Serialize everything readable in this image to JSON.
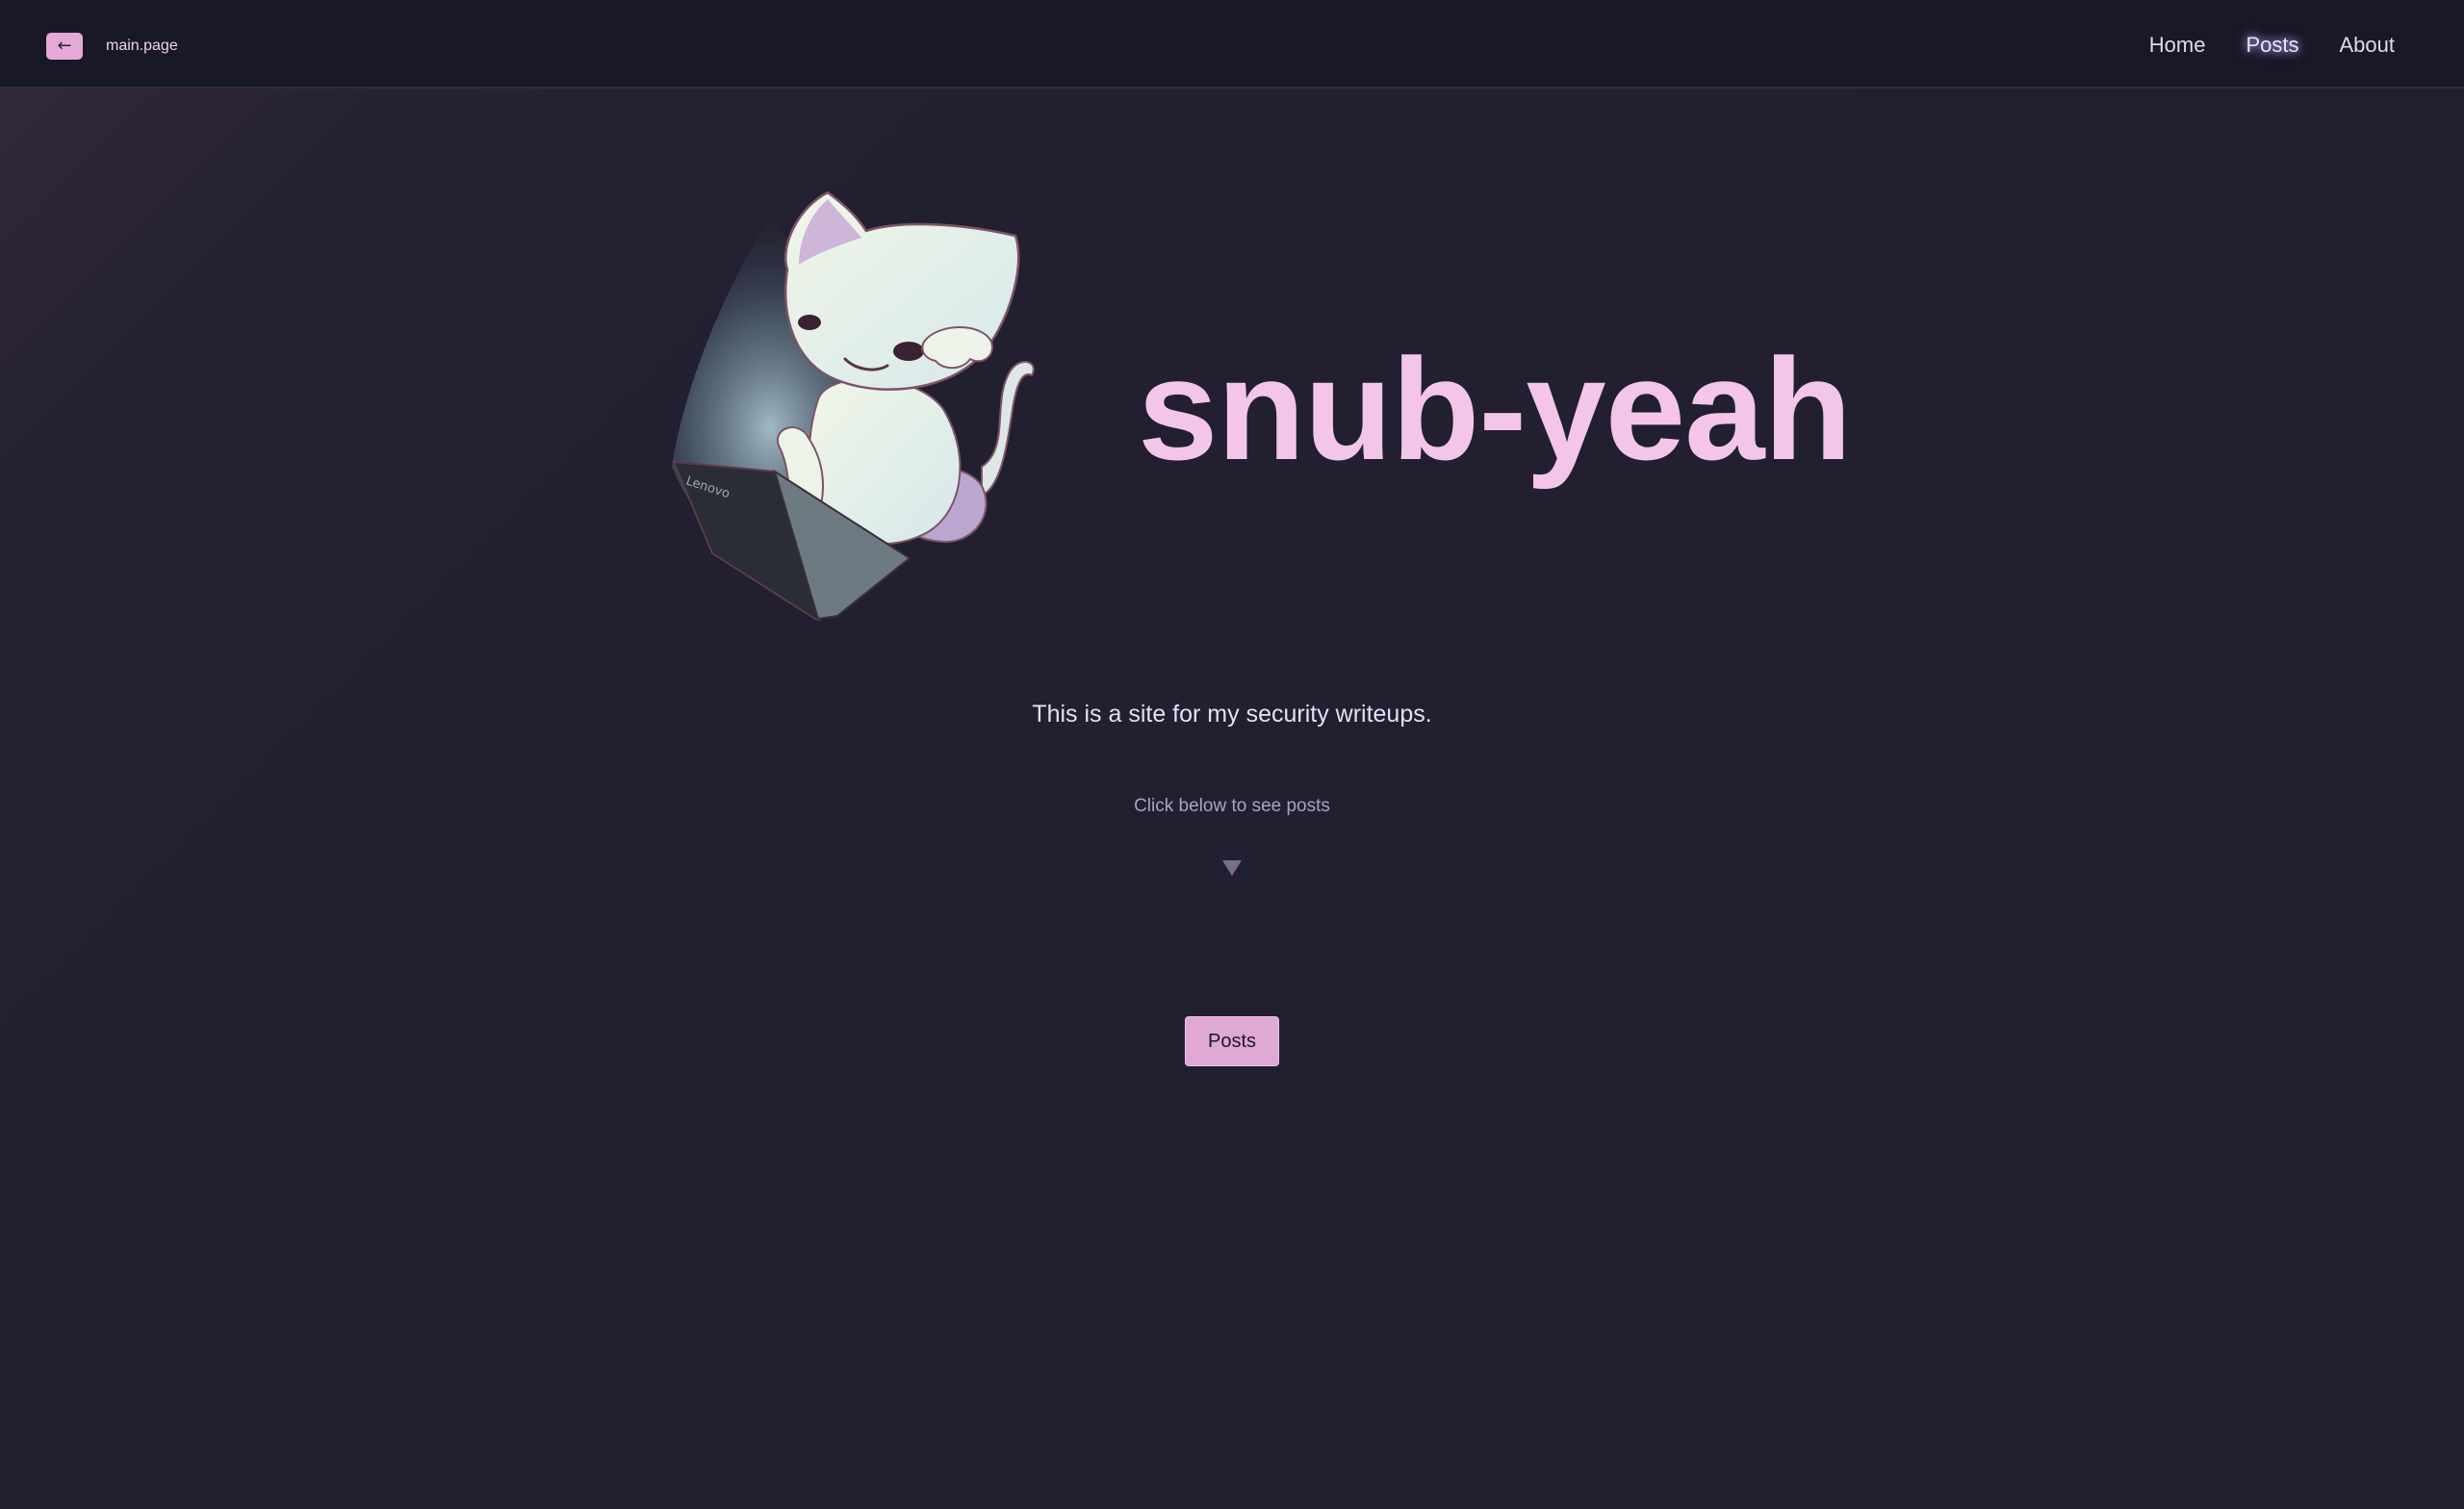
{
  "header": {
    "back_label": "←",
    "page_label": "main.page",
    "nav": [
      {
        "label": "Home"
      },
      {
        "label": "Posts",
        "active": true
      },
      {
        "label": "About"
      }
    ]
  },
  "hero": {
    "title": "snub-yeah",
    "laptop_text": "Lenovo",
    "tagline": "This is a site for my security writeups.",
    "hint": "Click below to see posts",
    "arrow_icon": "triangle-down-icon",
    "posts_button": "Posts"
  },
  "colors": {
    "accent": "#e0a8d4",
    "title": "#f3c5e6",
    "background": "#201f2f",
    "topbar": "#181826"
  }
}
